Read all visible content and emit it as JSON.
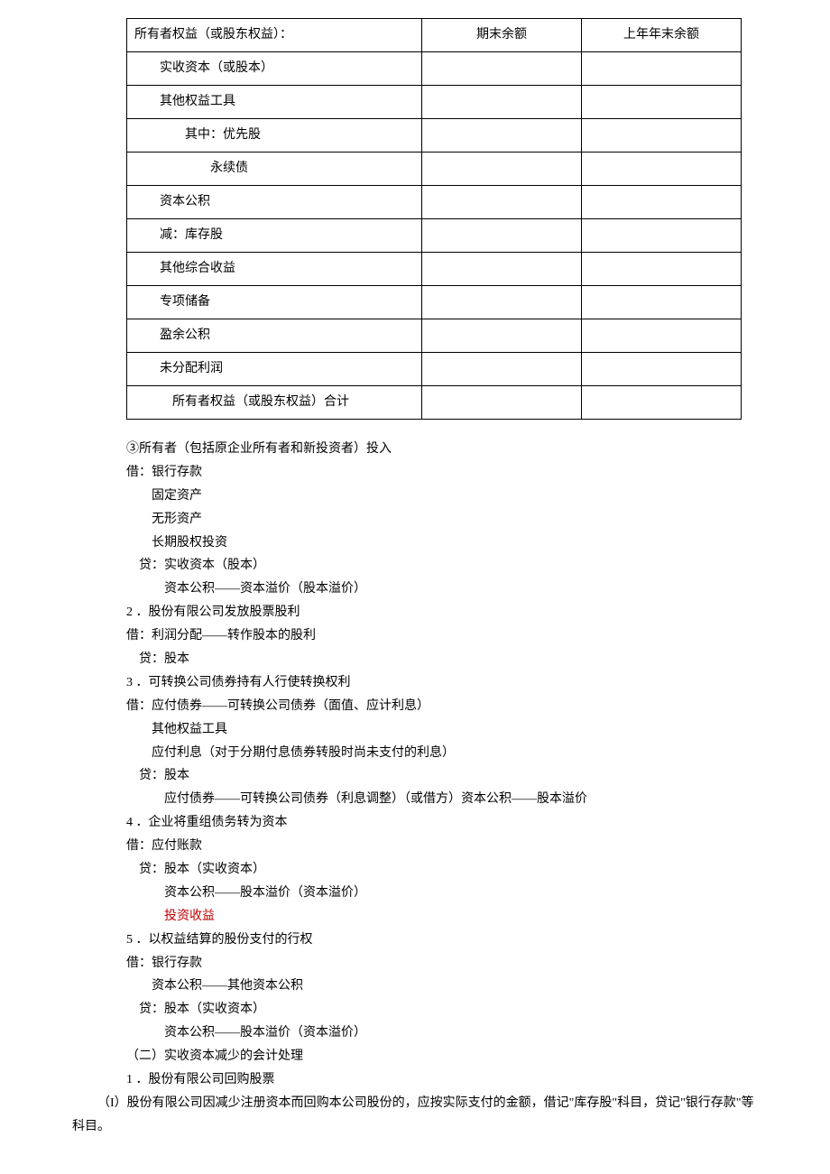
{
  "table": {
    "header": {
      "item": "所有者权益（或股东权益）：",
      "col1": "期末余额",
      "col2": "上年年末余额"
    },
    "rows": [
      {
        "item": "　　实收资本（或股本）",
        "col1": "",
        "col2": ""
      },
      {
        "item": "　　其他权益工具",
        "col1": "",
        "col2": ""
      },
      {
        "item": "　　　　其中：优先股",
        "col1": "",
        "col2": ""
      },
      {
        "item": "　　　　　　永续债",
        "col1": "",
        "col2": ""
      },
      {
        "item": "　　资本公积",
        "col1": "",
        "col2": ""
      },
      {
        "item": "　　减：库存股",
        "col1": "",
        "col2": ""
      },
      {
        "item": "　　其他综合收益",
        "col1": "",
        "col2": ""
      },
      {
        "item": "　　专项储备",
        "col1": "",
        "col2": ""
      },
      {
        "item": "　　盈余公积",
        "col1": "",
        "col2": ""
      },
      {
        "item": "　　未分配利润",
        "col1": "",
        "col2": ""
      },
      {
        "item": "　　　所有者权益（或股东权益）合计",
        "col1": "",
        "col2": ""
      }
    ]
  },
  "body": {
    "l1": "③所有者（包括原企业所有者和新投资者）投入",
    "l2": "借：银行存款",
    "l3": "固定资产",
    "l4": "无形资产",
    "l5": "长期股权投资",
    "l6": "贷：实收资本（股本）",
    "l7": "资本公积——资本溢价（股本溢价）",
    "l8": "2 ．股份有限公司发放股票股利",
    "l9": "借：利润分配——转作股本的股利",
    "l10": "贷：股本",
    "l11": "3 ．可转换公司债券持有人行使转换权利",
    "l12": "借：应付债券——可转换公司债券（面值、应计利息）",
    "l13": "其他权益工具",
    "l14": "应付利息（对于分期付息债券转股时尚未支付的利息）",
    "l15": "贷：股本",
    "l16": "应付债券——可转换公司债券（利息调整）（或借方）资本公积——股本溢价",
    "l17": "4 ．企业将重组债务转为资本",
    "l18": "借：应付账款",
    "l19": "贷：股本（实收资本）",
    "l20": "资本公积——股本溢价（资本溢价）",
    "l21": "投资收益",
    "l22": "5 ．以权益结算的股份支付的行权",
    "l23": "借：银行存款",
    "l24": "资本公积——其他资本公积",
    "l25": "贷：股本（实收资本）",
    "l26": "资本公积——股本溢价（资本溢价）",
    "l27": "（二）实收资本减少的会计处理",
    "l28": "1 ．股份有限公司回购股票",
    "l29": "（I）股份有限公司因减少注册资本而回购本公司股份的，应按实际支付的金额，借记\"库存股\"科目，贷记\"银行存款\"等科目。"
  }
}
